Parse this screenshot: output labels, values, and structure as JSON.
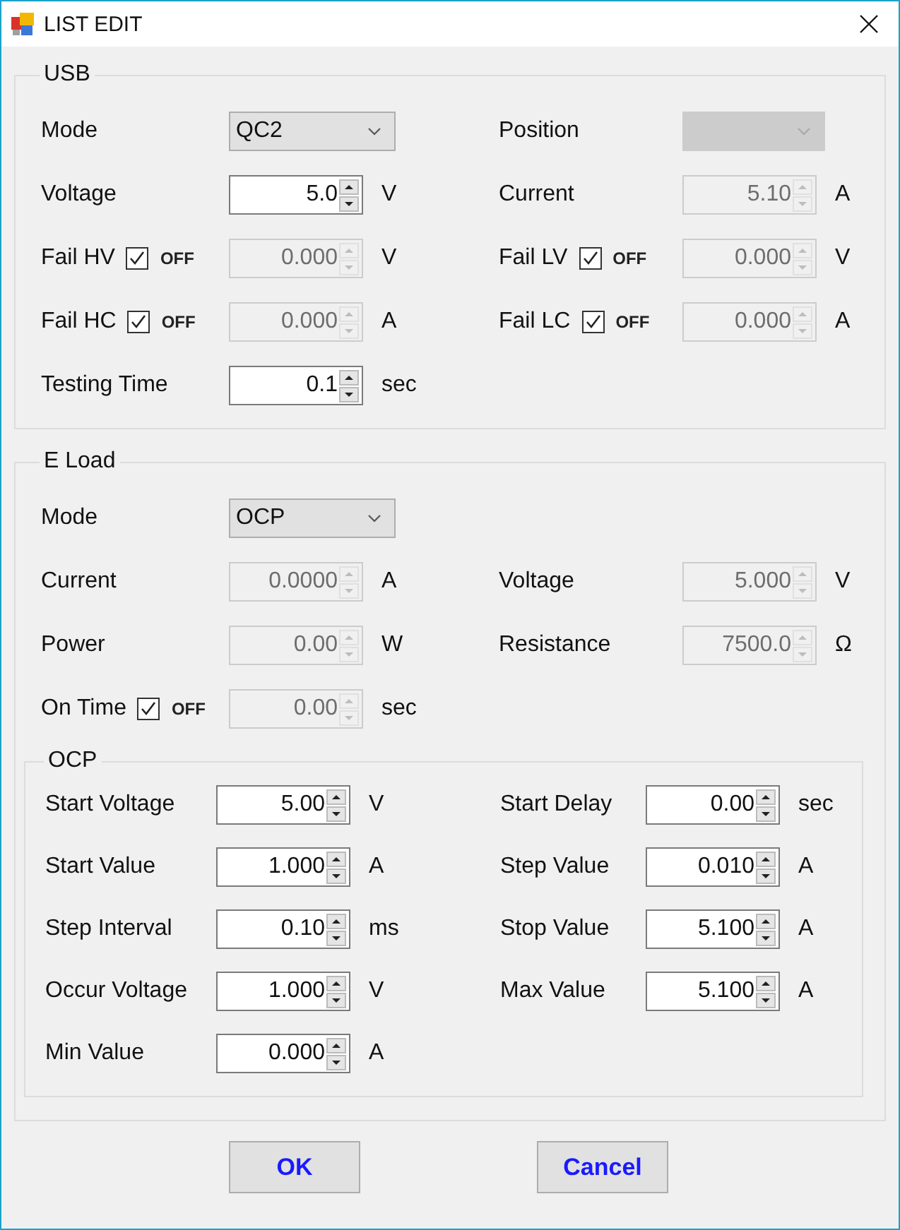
{
  "window": {
    "title": "LIST EDIT"
  },
  "groups": [
    {
      "title": "USB",
      "rows": [
        [
          {
            "label": "Mode",
            "kind": "dropdown",
            "value": "QC2",
            "disabled": false
          },
          {
            "label": "Position",
            "kind": "dropdown",
            "disabled": true
          }
        ],
        [
          {
            "label": "Voltage",
            "kind": "spin",
            "value": "5.0",
            "unit": "V",
            "disabled": false
          },
          {
            "label": "Current",
            "kind": "spin",
            "value": "5.10",
            "unit": "A",
            "disabled": true
          }
        ],
        [
          {
            "label": "Fail HV",
            "toggle": {
              "label": "OFF",
              "checked": true
            },
            "kind": "spin",
            "value": "0.000",
            "unit": "V",
            "disabled": true
          },
          {
            "label": "Fail LV",
            "toggle": {
              "label": "OFF",
              "checked": true
            },
            "kind": "spin",
            "value": "0.000",
            "unit": "V",
            "disabled": true
          }
        ],
        [
          {
            "label": "Fail HC",
            "toggle": {
              "label": "OFF",
              "checked": true
            },
            "kind": "spin",
            "value": "0.000",
            "unit": "A",
            "disabled": true
          },
          {
            "label": "Fail LC",
            "toggle": {
              "label": "OFF",
              "checked": true
            },
            "kind": "spin",
            "value": "0.000",
            "unit": "A",
            "disabled": true
          }
        ],
        [
          {
            "label": "Testing Time",
            "kind": "spin",
            "value": "0.1",
            "unit": "sec",
            "disabled": false
          }
        ]
      ]
    },
    {
      "title": "E Load",
      "rows": [
        [
          {
            "label": "Mode",
            "kind": "dropdown",
            "value": "OCP",
            "disabled": false
          }
        ],
        [
          {
            "label": "Current",
            "kind": "spin",
            "value": "0.0000",
            "unit": "A",
            "disabled": true
          },
          {
            "label": "Voltage",
            "kind": "spin",
            "value": "5.000",
            "unit": "V",
            "disabled": true
          }
        ],
        [
          {
            "label": "Power",
            "kind": "spin",
            "value": "0.00",
            "unit": "W",
            "disabled": true
          },
          {
            "label": "Resistance",
            "kind": "spin",
            "value": "7500.0",
            "unit": "Ω",
            "disabled": true
          }
        ],
        [
          {
            "label": "On Time",
            "toggle": {
              "label": "OFF",
              "checked": true
            },
            "kind": "spin",
            "value": "0.00",
            "unit": "sec",
            "disabled": true
          }
        ]
      ],
      "subgroup": {
        "title": "OCP",
        "rows": [
          [
            {
              "label": "Start Voltage",
              "kind": "spin",
              "value": "5.00",
              "unit": "V",
              "disabled": false
            },
            {
              "label": "Start Delay",
              "kind": "spin",
              "value": "0.00",
              "unit": "sec",
              "disabled": false
            }
          ],
          [
            {
              "label": "Start Value",
              "kind": "spin",
              "value": "1.000",
              "unit": "A",
              "disabled": false
            },
            {
              "label": "Step Value",
              "kind": "spin",
              "value": "0.010",
              "unit": "A",
              "disabled": false
            }
          ],
          [
            {
              "label": "Step Interval",
              "kind": "spin",
              "value": "0.10",
              "unit": "ms",
              "disabled": false
            },
            {
              "label": "Stop Value",
              "kind": "spin",
              "value": "5.100",
              "unit": "A",
              "disabled": false
            }
          ],
          [
            {
              "label": "Occur Voltage",
              "kind": "spin",
              "value": "1.000",
              "unit": "V",
              "disabled": false
            },
            {
              "label": "Max Value",
              "kind": "spin",
              "value": "5.100",
              "unit": "A",
              "disabled": false
            }
          ],
          [
            {
              "label": "Min Value",
              "kind": "spin",
              "value": "0.000",
              "unit": "A",
              "disabled": false
            }
          ]
        ]
      }
    }
  ],
  "buttons": [
    {
      "label": "OK"
    },
    {
      "label": "Cancel"
    }
  ]
}
